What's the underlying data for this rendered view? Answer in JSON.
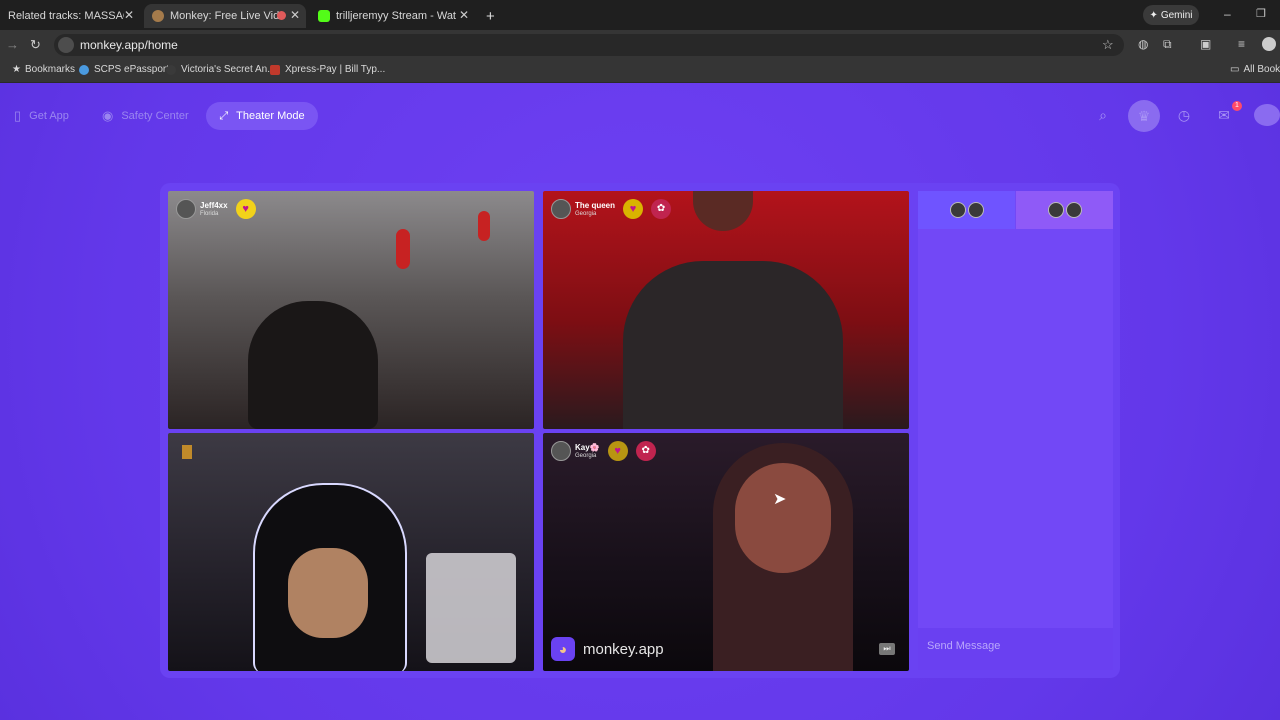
{
  "browser": {
    "tabs": [
      {
        "title": "Related tracks: MASSAGING ME",
        "active": false
      },
      {
        "title": "Monkey: Free Live Video Ch",
        "active": true
      },
      {
        "title": "trilljeremyy Stream - Watch Live",
        "active": false
      }
    ],
    "new_tab_label": "+",
    "gemini_label": "Gemini",
    "url": "monkey.app/home",
    "bookmarks": [
      {
        "label": "Bookmarks"
      },
      {
        "label": "SCPS ePassport"
      },
      {
        "label": "Victoria's Secret An..."
      },
      {
        "label": "Xpress-Pay | Bill Typ..."
      }
    ],
    "all_bookmarks_label": "All Bookm"
  },
  "app": {
    "nav": {
      "get_app": "Get App",
      "safety_center": "Safety Center",
      "theater_mode": "Theater Mode"
    },
    "notification_count": "1",
    "tiles": [
      {
        "name": "Jeff4xx",
        "location": "Florida",
        "bg": "#4d4a4a"
      },
      {
        "name": "The queen",
        "location": "Georgia",
        "bg": "#7a0f14"
      },
      {
        "name": "",
        "location": "",
        "bg": "#1f1c24"
      },
      {
        "name": "Kay🌸",
        "location": "Georgia",
        "bg": "#16101a"
      }
    ],
    "watermark": "monkey.app",
    "chat": {
      "send_placeholder": "Send Message"
    }
  },
  "colors": {
    "page_bg": "#6a3cf0",
    "panel_bg": "#7248f6",
    "accent": "#7a55f3"
  }
}
